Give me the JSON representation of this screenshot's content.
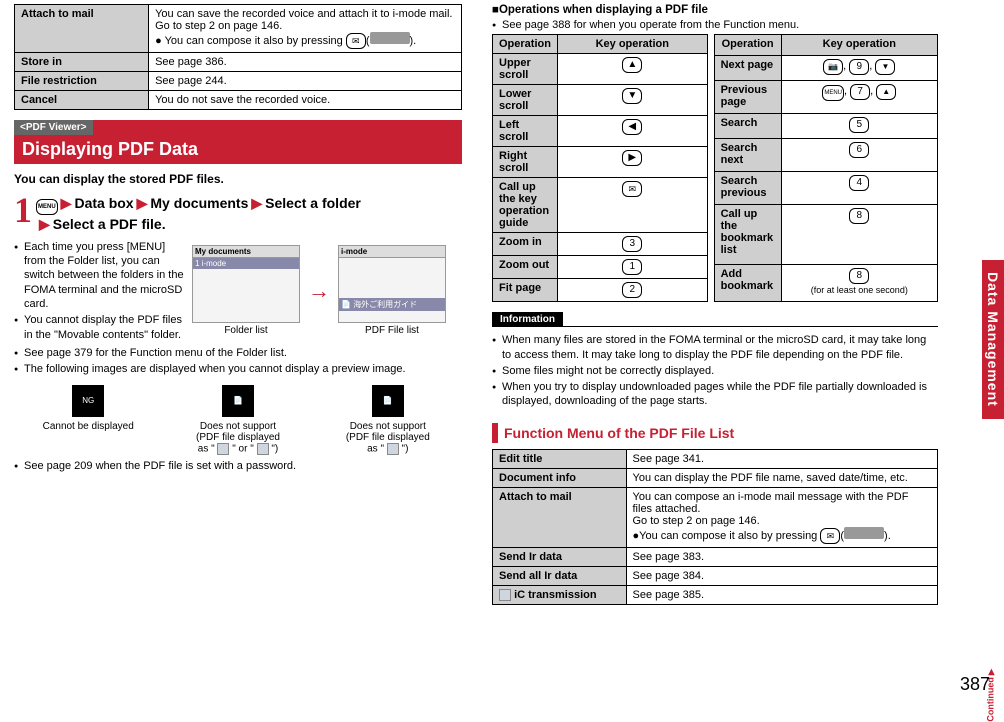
{
  "left": {
    "table1": [
      {
        "label": "Attach to mail",
        "body": "You can save the recorded voice and attach it to i-mode mail.\nGo to step 2 on page 146.",
        "extra": "You can compose it also by pressing",
        "keyglyph": "✉"
      },
      {
        "label": "Store in",
        "body": "See page 386."
      },
      {
        "label": "File restriction",
        "body": "See page 244."
      },
      {
        "label": "Cancel",
        "body": "You do not save the recorded voice."
      }
    ],
    "section_tag": "<PDF Viewer>",
    "section_title": "Displaying PDF Data",
    "intro": "You can display the stored PDF files.",
    "step1": {
      "num": "1",
      "menu": "MENU",
      "parts": [
        "Data box",
        "My documents",
        "Select a folder",
        "Select a PDF file."
      ]
    },
    "bullets1": [
      "Each time you press [MENU] from the Folder list, you can switch between the folders in the FOMA terminal and the microSD card.",
      "You cannot display the PDF files in the \"Movable contents\" folder."
    ],
    "bullets2": [
      "See page 379 for the Function menu of the Folder list.",
      "The following images are displayed when you cannot display a preview image."
    ],
    "screen1": {
      "title": "My documents",
      "row": "i-mode"
    },
    "screen2": {
      "title": "i-mode",
      "row": "海外ご利用ガイド"
    },
    "caption1": "Folder list",
    "caption2": "PDF File list",
    "icons": {
      "a": "Cannot be displayed",
      "b": "Does not support\n(PDF file displayed\nas \"   \" or \"   \")",
      "c": "Does not support\n(PDF file displayed\nas \"   \")"
    },
    "footnote": "See page 209 when the PDF file is set with a password."
  },
  "right": {
    "heading": "Operations when displaying a PDF file",
    "heading_note": "See page 388 for when you operate from the Function menu.",
    "tableA": {
      "header": [
        "Operation",
        "Key operation"
      ],
      "rows": [
        {
          "op": "Upper scroll",
          "key": "▲"
        },
        {
          "op": "Lower scroll",
          "key": "▼"
        },
        {
          "op": "Left scroll",
          "key": "◀"
        },
        {
          "op": "Right scroll",
          "key": "▶"
        },
        {
          "op": "Call up the key operation guide",
          "key": "✉"
        },
        {
          "op": "Zoom in",
          "key": "3"
        },
        {
          "op": "Zoom out",
          "key": "1"
        },
        {
          "op": "Fit page",
          "key": "2"
        }
      ]
    },
    "tableB": {
      "header": [
        "Operation",
        "Key operation"
      ],
      "rows": [
        {
          "op": "Next page",
          "key": "📷, 9, ▼"
        },
        {
          "op": "Previous page",
          "key": "MENU, 7, ▲"
        },
        {
          "op": "Search",
          "key": "5"
        },
        {
          "op": "Search next",
          "key": "6"
        },
        {
          "op": "Search previous",
          "key": "4"
        },
        {
          "op": "Call up the bookmark list",
          "key": "8"
        },
        {
          "op": "Add bookmark",
          "key": "8",
          "note": "(for at least one second)"
        }
      ]
    },
    "info_label": "Information",
    "info": [
      "When many files are stored in the FOMA terminal or the microSD card, it may take long to access them. It may take long to display the PDF file depending on the PDF file.",
      "Some files might not be correctly displayed.",
      "When you try to display undownloaded pages while the PDF file partially downloaded is displayed, downloading of the page starts."
    ],
    "fn_header": "Function Menu of the PDF File List",
    "fn_table": [
      {
        "label": "Edit title",
        "body": "See page 341."
      },
      {
        "label": "Document info",
        "body": "You can display the PDF file name, saved date/time, etc."
      },
      {
        "label": "Attach to mail",
        "body": "You can compose an i-mode mail message with the PDF files attached.\nGo to step 2 on page 146.",
        "extra": "You can compose it also by pressing",
        "keyglyph": "✉"
      },
      {
        "label": "Send Ir data",
        "body": "See page 383."
      },
      {
        "label": "Send all Ir data",
        "body": "See page 384."
      },
      {
        "label": "iC transmission",
        "icon": "iC",
        "body": "See page 385."
      }
    ]
  },
  "side_tab": "Data Management",
  "continued": "Continued",
  "page_num": "387"
}
